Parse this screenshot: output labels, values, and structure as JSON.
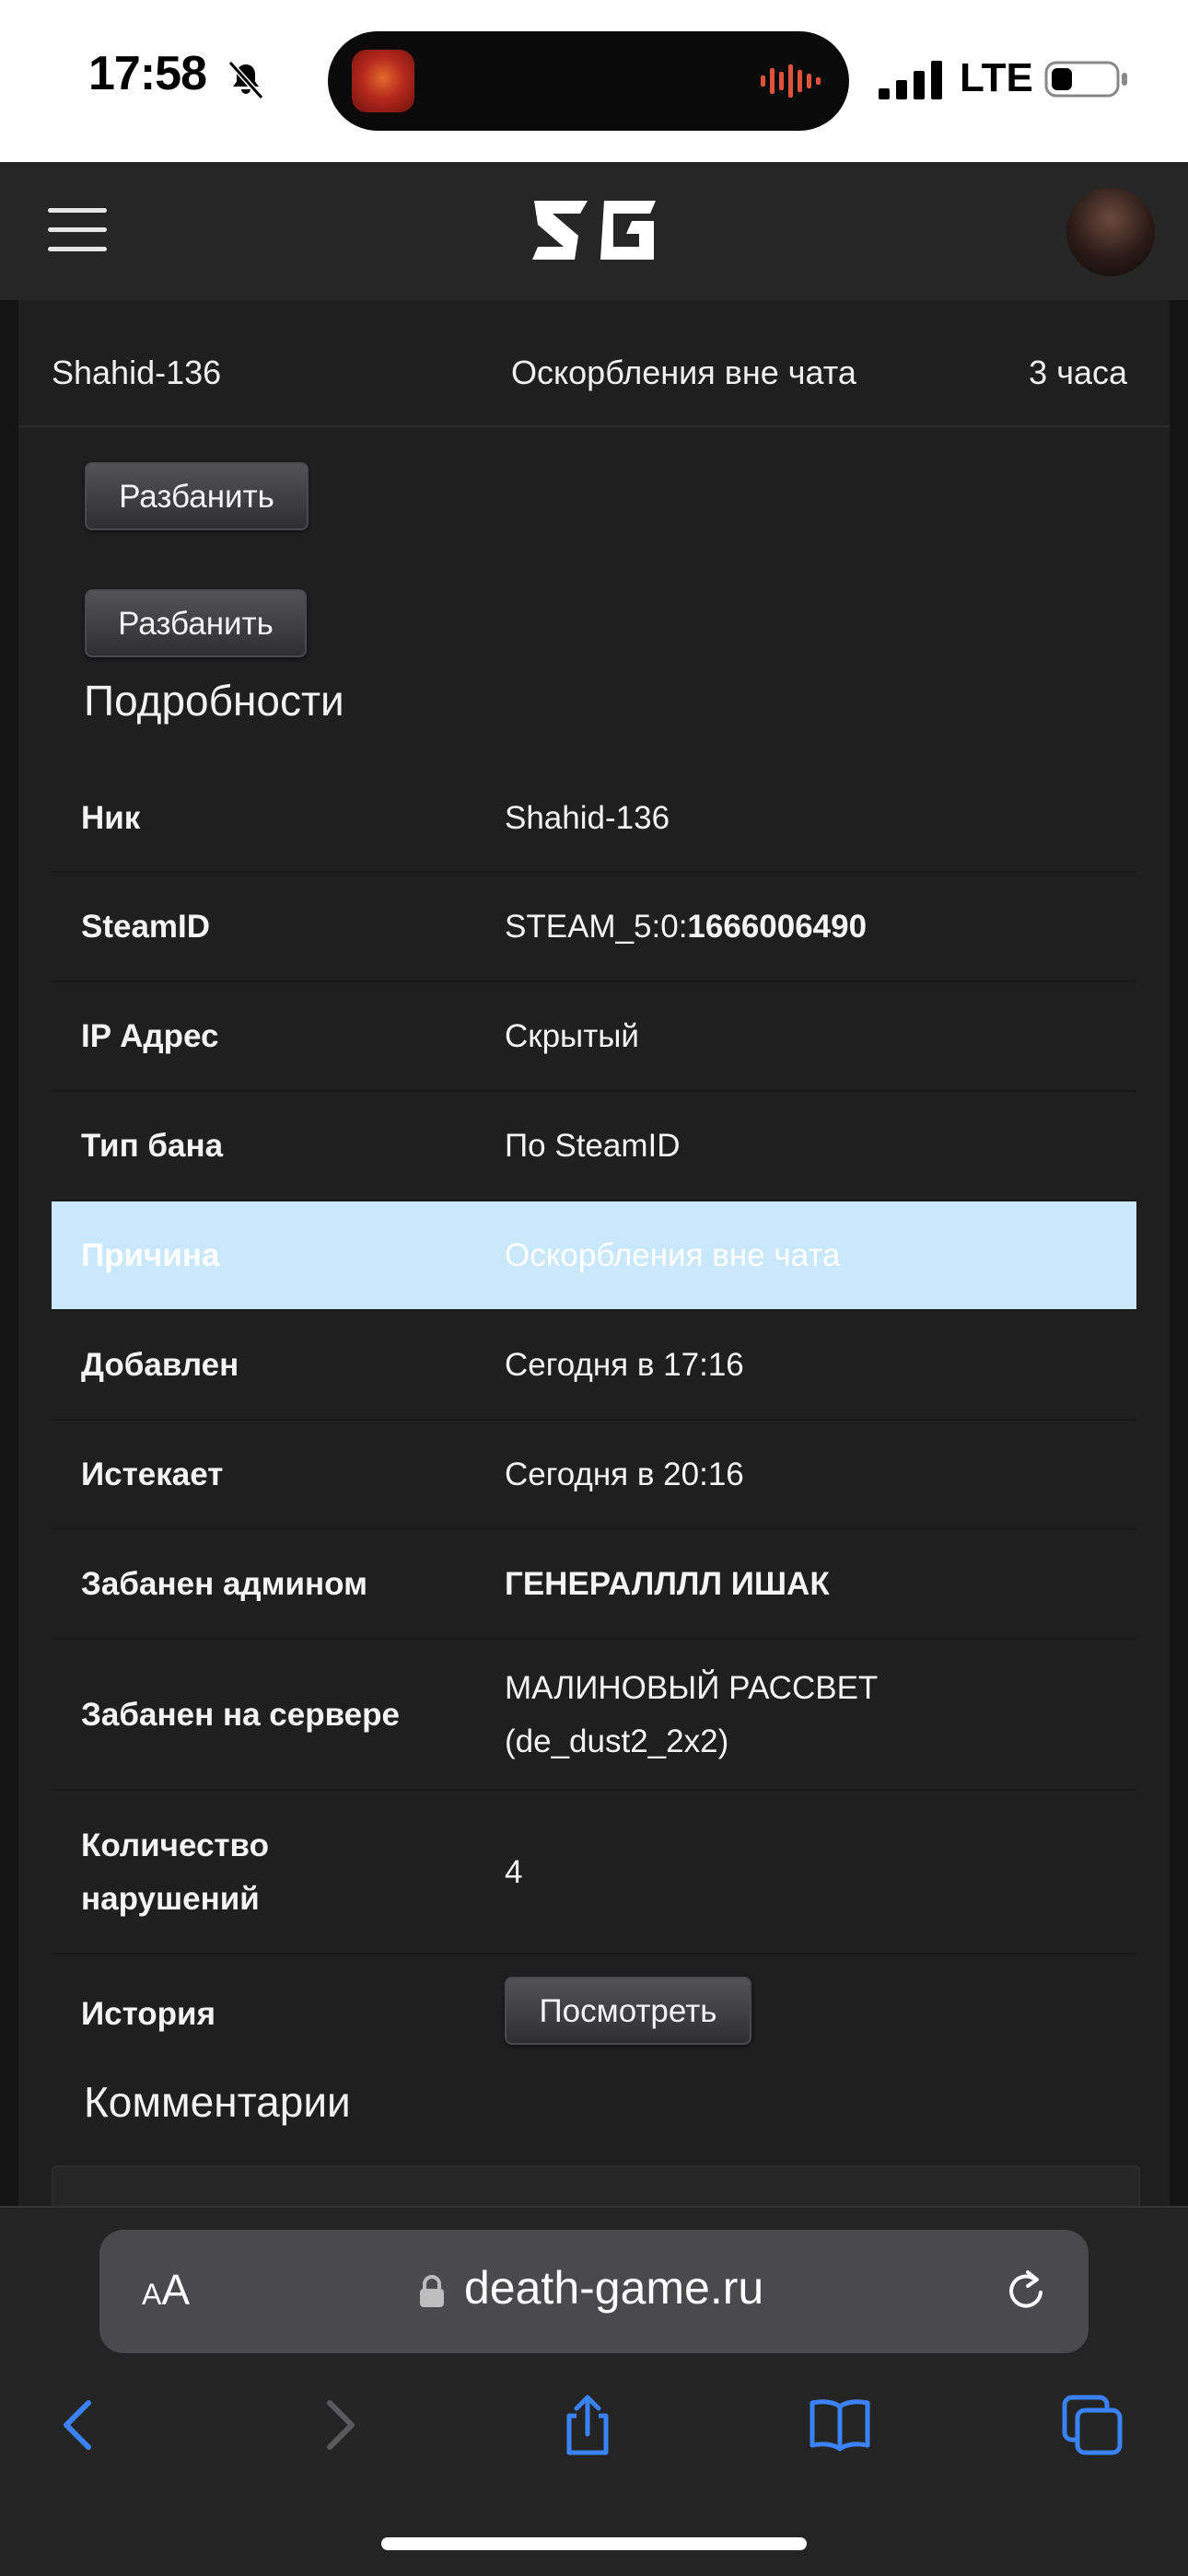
{
  "status_bar": {
    "time": "17:58",
    "network": "LTE"
  },
  "header": {
    "logo_text": "DG"
  },
  "ban_row": {
    "player": "Shahid-136",
    "reason": "Оскорбления вне чата",
    "duration": "3 часа"
  },
  "actions": {
    "unban_1": "Разбанить",
    "unban_2": "Разбанить"
  },
  "details": {
    "title": "Подробности",
    "rows": [
      {
        "label": "Ник",
        "value": "Shahid-136"
      },
      {
        "label": "SteamID",
        "value_prefix": "STEAM_5:0:",
        "value_bold": "1666006490"
      },
      {
        "label": "IP Адрес",
        "value": "Скрытый"
      },
      {
        "label": "Тип бана",
        "value": "По SteamID"
      },
      {
        "label": "Причина",
        "value": "Оскорбления вне чата"
      },
      {
        "label": "Добавлен",
        "value": "Сегодня в 17:16"
      },
      {
        "label": "Истекает",
        "value": "Сегодня в 20:16"
      },
      {
        "label": "Забанен админом",
        "value": "ГЕНЕРАЛЛЛЛ ИШАК"
      },
      {
        "label": "Забанен на сервере",
        "value_line1": "МАЛИНОВЫЙ РАССВЕТ",
        "value_line2": "(de_dust2_2x2)"
      },
      {
        "label_line1": "Количество",
        "label_line2": "нарушений",
        "value": "4"
      },
      {
        "label": "История",
        "button": "Посмотреть"
      }
    ]
  },
  "comments": {
    "title": "Комментарии"
  },
  "safari": {
    "text_size": "AA",
    "url": "death-game.ru"
  },
  "colors": {
    "highlight_row": "#c9e8fb",
    "link_blue": "#3b82f6"
  }
}
